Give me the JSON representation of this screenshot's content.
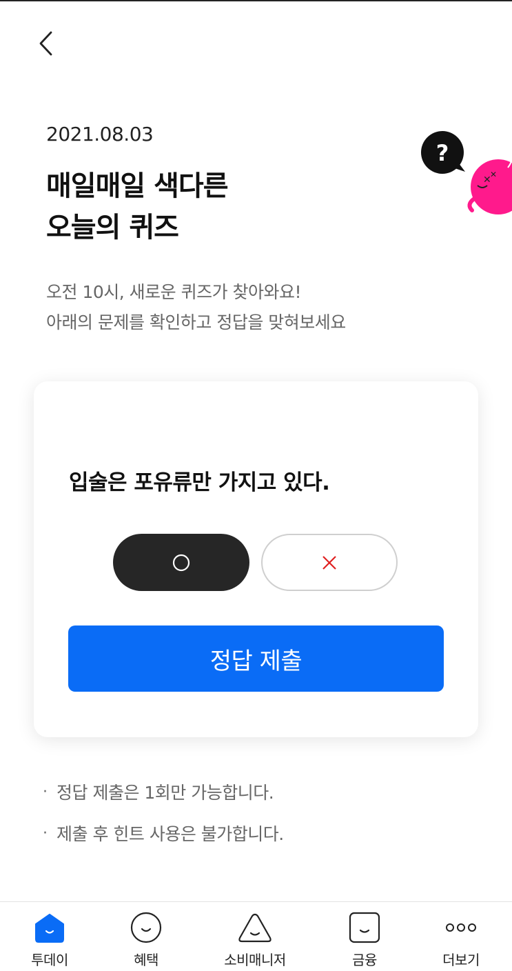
{
  "header": {
    "back_icon": "chevron-left-icon"
  },
  "quiz": {
    "date": "2021.08.03",
    "title_line1": "매일매일 색다른",
    "title_line2": "오늘의 퀴즈",
    "desc_line1": "오전 10시, 새로운 퀴즈가 찾아와요!",
    "desc_line2": "아래의 문제를 확인하고 정답을 맞혀보세요",
    "mascot_bubble": "?",
    "question": "입술은 포유류만 가지고 있다.",
    "option_true": "○",
    "option_false": "✕",
    "selected_option": "true",
    "submit_label": "정답 제출"
  },
  "notes": [
    "정답 제출은 1회만 가능합니다.",
    "제출 후 힌트 사용은 불가합니다."
  ],
  "nav": {
    "items": [
      {
        "label": "투데이",
        "icon": "home-icon",
        "active": true
      },
      {
        "label": "혜택",
        "icon": "smile-circle-icon"
      },
      {
        "label": "소비매니저",
        "icon": "triangle-face-icon"
      },
      {
        "label": "금융",
        "icon": "square-face-icon"
      },
      {
        "label": "더보기",
        "icon": "more-dots-icon"
      }
    ]
  },
  "colors": {
    "accent": "#0a6cf6",
    "selected_option_bg": "#262626",
    "false_mark": "#e02020",
    "mascot": "#ff1a8c"
  }
}
